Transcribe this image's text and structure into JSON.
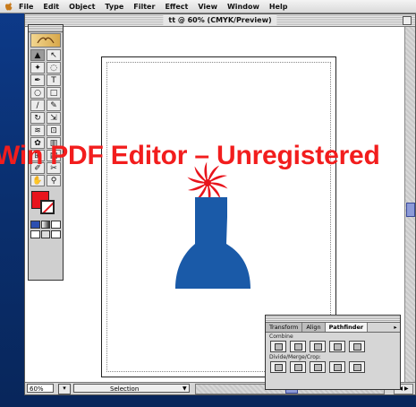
{
  "menu_bar": {
    "items": [
      "File",
      "Edit",
      "Object",
      "Type",
      "Filter",
      "Effect",
      "View",
      "Window",
      "Help"
    ]
  },
  "document": {
    "title": "tt @ 60% (CMYK/Preview)"
  },
  "artwork": {
    "vase_color": "#1a5aa8",
    "flower_color": "#e8141c"
  },
  "tools_palette": {
    "fill_color": "#e8141c",
    "stroke_color": "#ffffff",
    "tools": [
      {
        "icon": "selection-arrow-icon",
        "glyph": "▲"
      },
      {
        "icon": "direct-selection-icon",
        "glyph": "↖"
      },
      {
        "icon": "magic-wand-icon",
        "glyph": "✦"
      },
      {
        "icon": "lasso-icon",
        "glyph": "◌"
      },
      {
        "icon": "pen-tool-icon",
        "glyph": "✒"
      },
      {
        "icon": "type-tool-icon",
        "glyph": "T"
      },
      {
        "icon": "ellipse-tool-icon",
        "glyph": "○"
      },
      {
        "icon": "rectangle-tool-icon",
        "glyph": "□"
      },
      {
        "icon": "brush-tool-icon",
        "glyph": "∕"
      },
      {
        "icon": "pencil-tool-icon",
        "glyph": "✎"
      },
      {
        "icon": "rotate-tool-icon",
        "glyph": "↻"
      },
      {
        "icon": "scale-tool-icon",
        "glyph": "⇲"
      },
      {
        "icon": "warp-tool-icon",
        "glyph": "≋"
      },
      {
        "icon": "free-transform-icon",
        "glyph": "⊡"
      },
      {
        "icon": "symbol-sprayer-icon",
        "glyph": "✿"
      },
      {
        "icon": "graph-tool-icon",
        "glyph": "▥"
      },
      {
        "icon": "mesh-tool-icon",
        "glyph": "⊞"
      },
      {
        "icon": "gradient-tool-icon",
        "glyph": "▤"
      },
      {
        "icon": "eyedropper-icon",
        "glyph": "✐"
      },
      {
        "icon": "scissors-icon",
        "glyph": "✂"
      },
      {
        "icon": "hand-tool-icon",
        "glyph": "✋"
      },
      {
        "icon": "zoom-tool-icon",
        "glyph": "⚲"
      }
    ]
  },
  "status_bar": {
    "zoom": "60%",
    "tool": "Selection"
  },
  "pathfinder_palette": {
    "tabs": [
      "Transform",
      "Align",
      "Pathfinder"
    ],
    "active_tab": "Pathfinder",
    "combine_label": "Combine",
    "divide_label": "Divide/Merge/Crop:"
  },
  "watermark": {
    "text": "Win PDF Editor – Unregistered"
  }
}
